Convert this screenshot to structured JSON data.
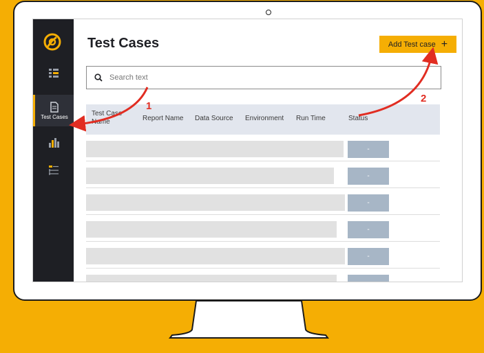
{
  "app": {
    "title": "Test Cases",
    "add_button_label": "Add Test case",
    "add_button_icon": "+"
  },
  "sidebar": {
    "items": [
      {
        "icon": "list-icon",
        "label": ""
      },
      {
        "icon": "document-icon",
        "label": "Test Cases"
      },
      {
        "icon": "bar-chart-icon",
        "label": ""
      },
      {
        "icon": "flow-icon",
        "label": ""
      }
    ]
  },
  "search": {
    "placeholder": "Search text",
    "value": ""
  },
  "table": {
    "columns": [
      "Test Case Name",
      "Report Name",
      "Data Source",
      "Environment",
      "Run Time",
      "Status"
    ],
    "status_placeholder": "-",
    "row_count": 6
  },
  "annotations": {
    "first": "1",
    "second": "2"
  },
  "colors": {
    "accent": "#F5AE04",
    "sidebar": "#1e1f24",
    "arrow": "#e12d22",
    "status_pill": "#a7b6c6",
    "header_bg": "#e2e6ee"
  }
}
